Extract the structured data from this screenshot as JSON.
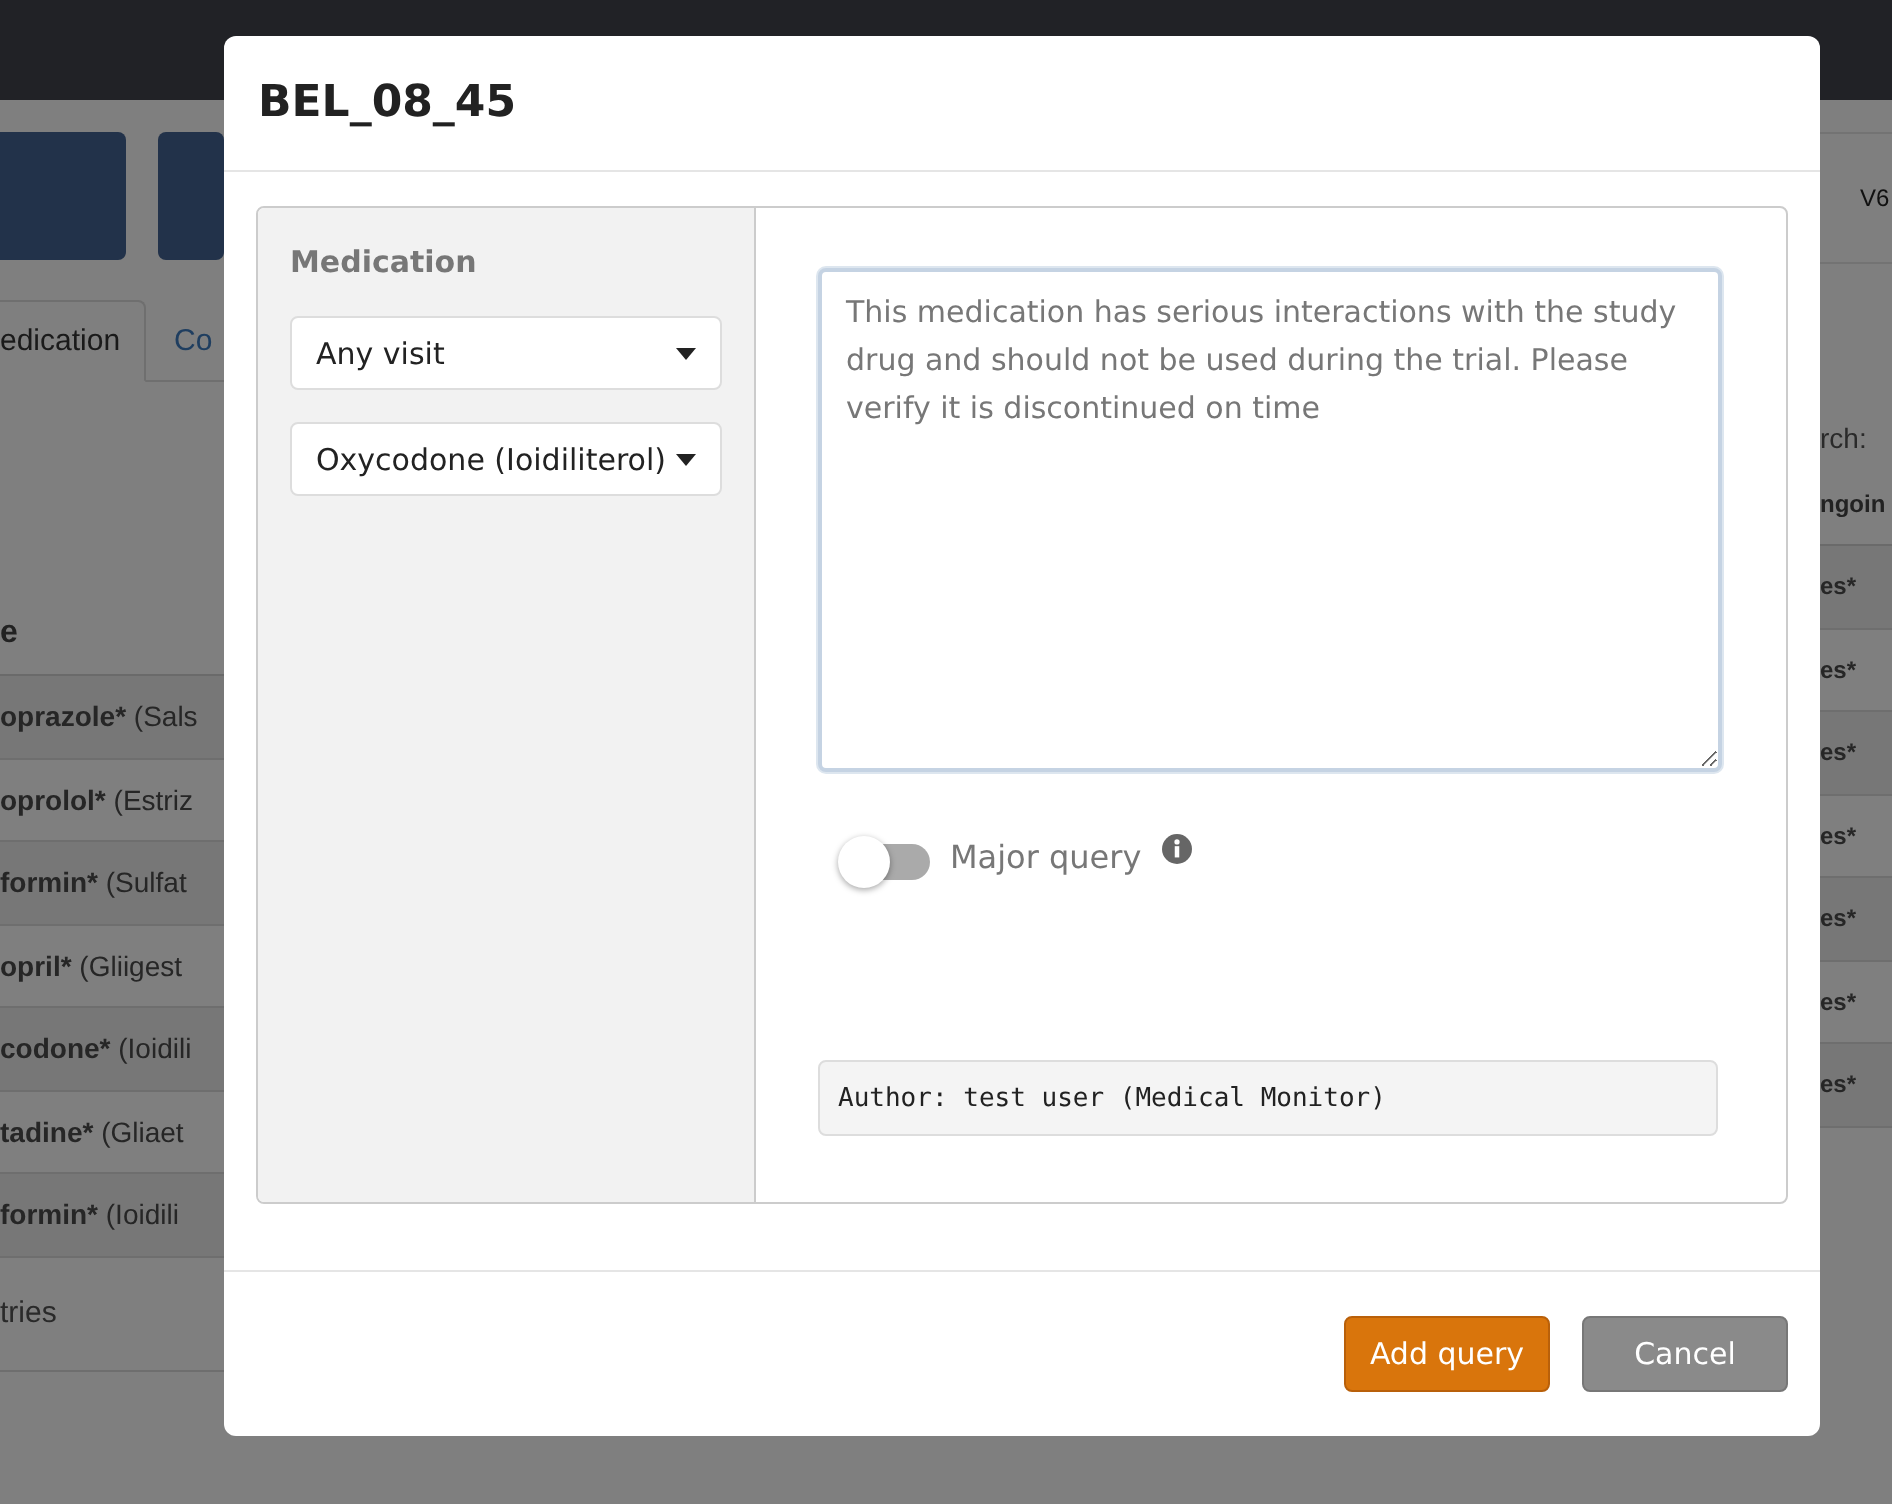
{
  "background": {
    "tabs": [
      {
        "label": "edication",
        "selected": true
      },
      {
        "label": "Co",
        "selected": false
      }
    ],
    "version": "V6",
    "search_label": "rch:",
    "table": {
      "columns": [
        "e",
        "ngoin"
      ],
      "rows": [
        {
          "name": "oprazole*",
          "brand": "(Sals",
          "column_2": "es*"
        },
        {
          "name": "oprolol*",
          "brand": "(Estriz",
          "column_2": "es*"
        },
        {
          "name": "formin*",
          "brand": "(Sulfat",
          "column_2": "es*"
        },
        {
          "name": "opril*",
          "brand": "(Gliigest",
          "column_2": "es*"
        },
        {
          "name": "codone*",
          "brand": "(Ioidili",
          "column_2": "es*"
        },
        {
          "name": "tadine*",
          "brand": "(Gliaet",
          "column_2": "es*"
        },
        {
          "name": "formin*",
          "brand": "(Ioidili",
          "column_2": "es*"
        }
      ],
      "footer": "tries"
    }
  },
  "dialog": {
    "title": "BEL_08_45",
    "sidebar": {
      "heading": "Medication",
      "selects": [
        "Any visit",
        "Oxycodone (Ioidiliterol)"
      ]
    },
    "comment": {
      "placeholder": "This medication has serious interactions with the study drug and should not be used during the trial. Please verify it is discontinued on time"
    },
    "toggle": {
      "label": "Major query",
      "on": false
    },
    "author": "Author: test user (Medical Monitor)",
    "buttons": [
      {
        "label": "Add query",
        "kind": "primary"
      },
      {
        "label": "Cancel",
        "kind": "secondary"
      }
    ]
  }
}
